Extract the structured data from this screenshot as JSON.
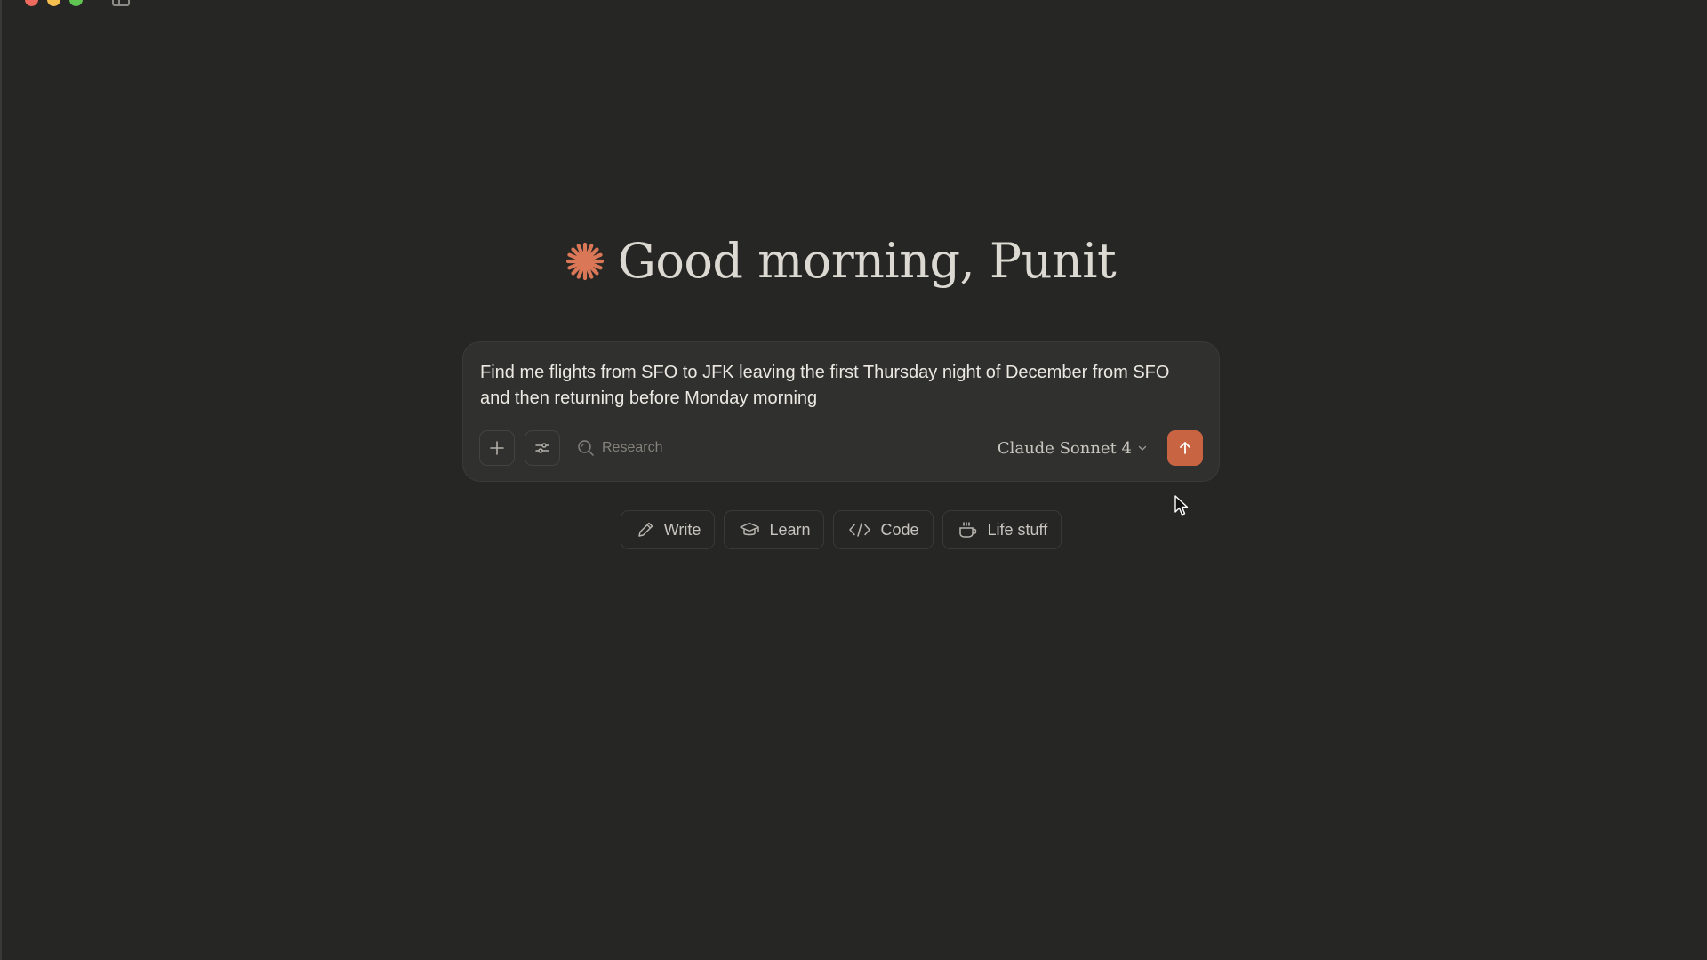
{
  "window": {
    "controls": [
      "close",
      "minimize",
      "maximize"
    ]
  },
  "greeting": {
    "text": "Good morning, Punit",
    "icon": "claude-asterisk-icon"
  },
  "composer": {
    "prompt": "Find me flights from SFO to JFK leaving the first Thursday night of December from SFO and then returning before Monday morning",
    "research_label": "Research",
    "model_label": "Claude Sonnet 4",
    "send_icon": "arrow-up-icon"
  },
  "chips": [
    {
      "label": "Write",
      "icon": "pencil-icon"
    },
    {
      "label": "Learn",
      "icon": "graduation-cap-icon"
    },
    {
      "label": "Code",
      "icon": "code-icon"
    },
    {
      "label": "Life stuff",
      "icon": "coffee-cup-icon"
    }
  ],
  "colors": {
    "background": "#262624",
    "accent": "#c96442",
    "composer": "#30302e"
  }
}
